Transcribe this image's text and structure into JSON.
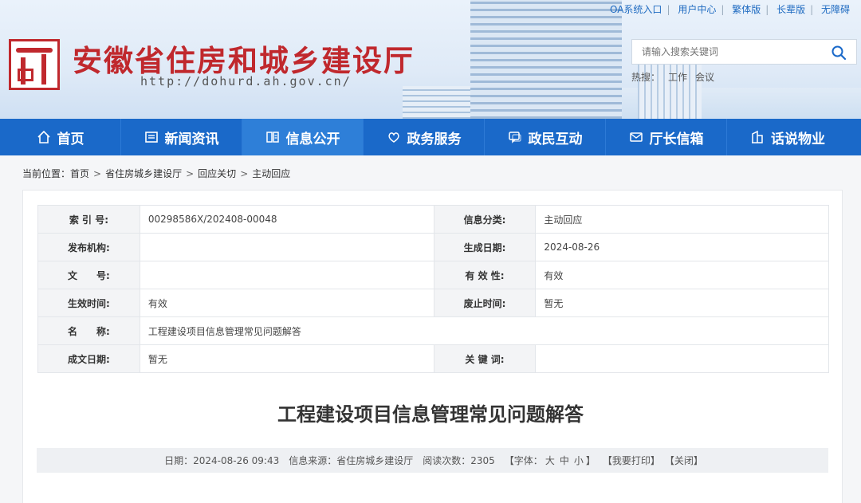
{
  "header": {
    "site_title": "安徽省住房和城乡建设厅",
    "site_url": "http://dohurd.ah.gov.cn/",
    "top_links": [
      "OA系统入口",
      "用户中心",
      "繁体版",
      "长辈版",
      "无障碍"
    ],
    "search_placeholder": "请输入搜索关键词",
    "hot_label": "热搜：",
    "hot_words": [
      "工作",
      "会议"
    ],
    "brand_color": "#c0282d"
  },
  "nav": {
    "items": [
      {
        "label": "首页",
        "icon": "home-icon"
      },
      {
        "label": "新闻资讯",
        "icon": "news-icon"
      },
      {
        "label": "信息公开",
        "icon": "book-icon"
      },
      {
        "label": "政务服务",
        "icon": "service-icon"
      },
      {
        "label": "政民互动",
        "icon": "chat-icon"
      },
      {
        "label": "厅长信箱",
        "icon": "mail-icon"
      },
      {
        "label": "话说物业",
        "icon": "building-icon"
      }
    ],
    "color": "#1a69c9"
  },
  "breadcrumb": {
    "prefix": "当前位置：",
    "items": [
      "首页",
      "省住房城乡建设厅",
      "回应关切",
      "主动回应"
    ]
  },
  "meta": {
    "index_label": "索 引 号:",
    "index_value": "00298586X/202408-00048",
    "category_label": "信息分类:",
    "category_value": "主动回应",
    "publisher_label": "发布机构:",
    "publisher_value": "",
    "generated_label": "生成日期:",
    "generated_value": "2024-08-26",
    "docno_label": "文　　号:",
    "docno_value": "",
    "validity_label": "有 效 性:",
    "validity_value": "有效",
    "effective_label": "生效时间:",
    "effective_value": "有效",
    "repeal_label": "废止时间:",
    "repeal_value": "暂无",
    "name_label": "名　　称:",
    "name_value": "工程建设项目信息管理常见问题解答",
    "written_label": "成文日期:",
    "written_value": "暂无",
    "keywords_label": "关 键 词:",
    "keywords_value": ""
  },
  "article": {
    "title": "工程建设项目信息管理常见问题解答",
    "date": "日期：2024-08-26 09:43",
    "source": "信息来源：省住房城乡建设厅",
    "views": "阅读次数：2305",
    "font_prefix": "【字体：",
    "font_large": "大",
    "font_medium": "中",
    "font_small": "小",
    "font_suffix": "】",
    "print": "【我要打印】",
    "close": "【关闭】"
  }
}
